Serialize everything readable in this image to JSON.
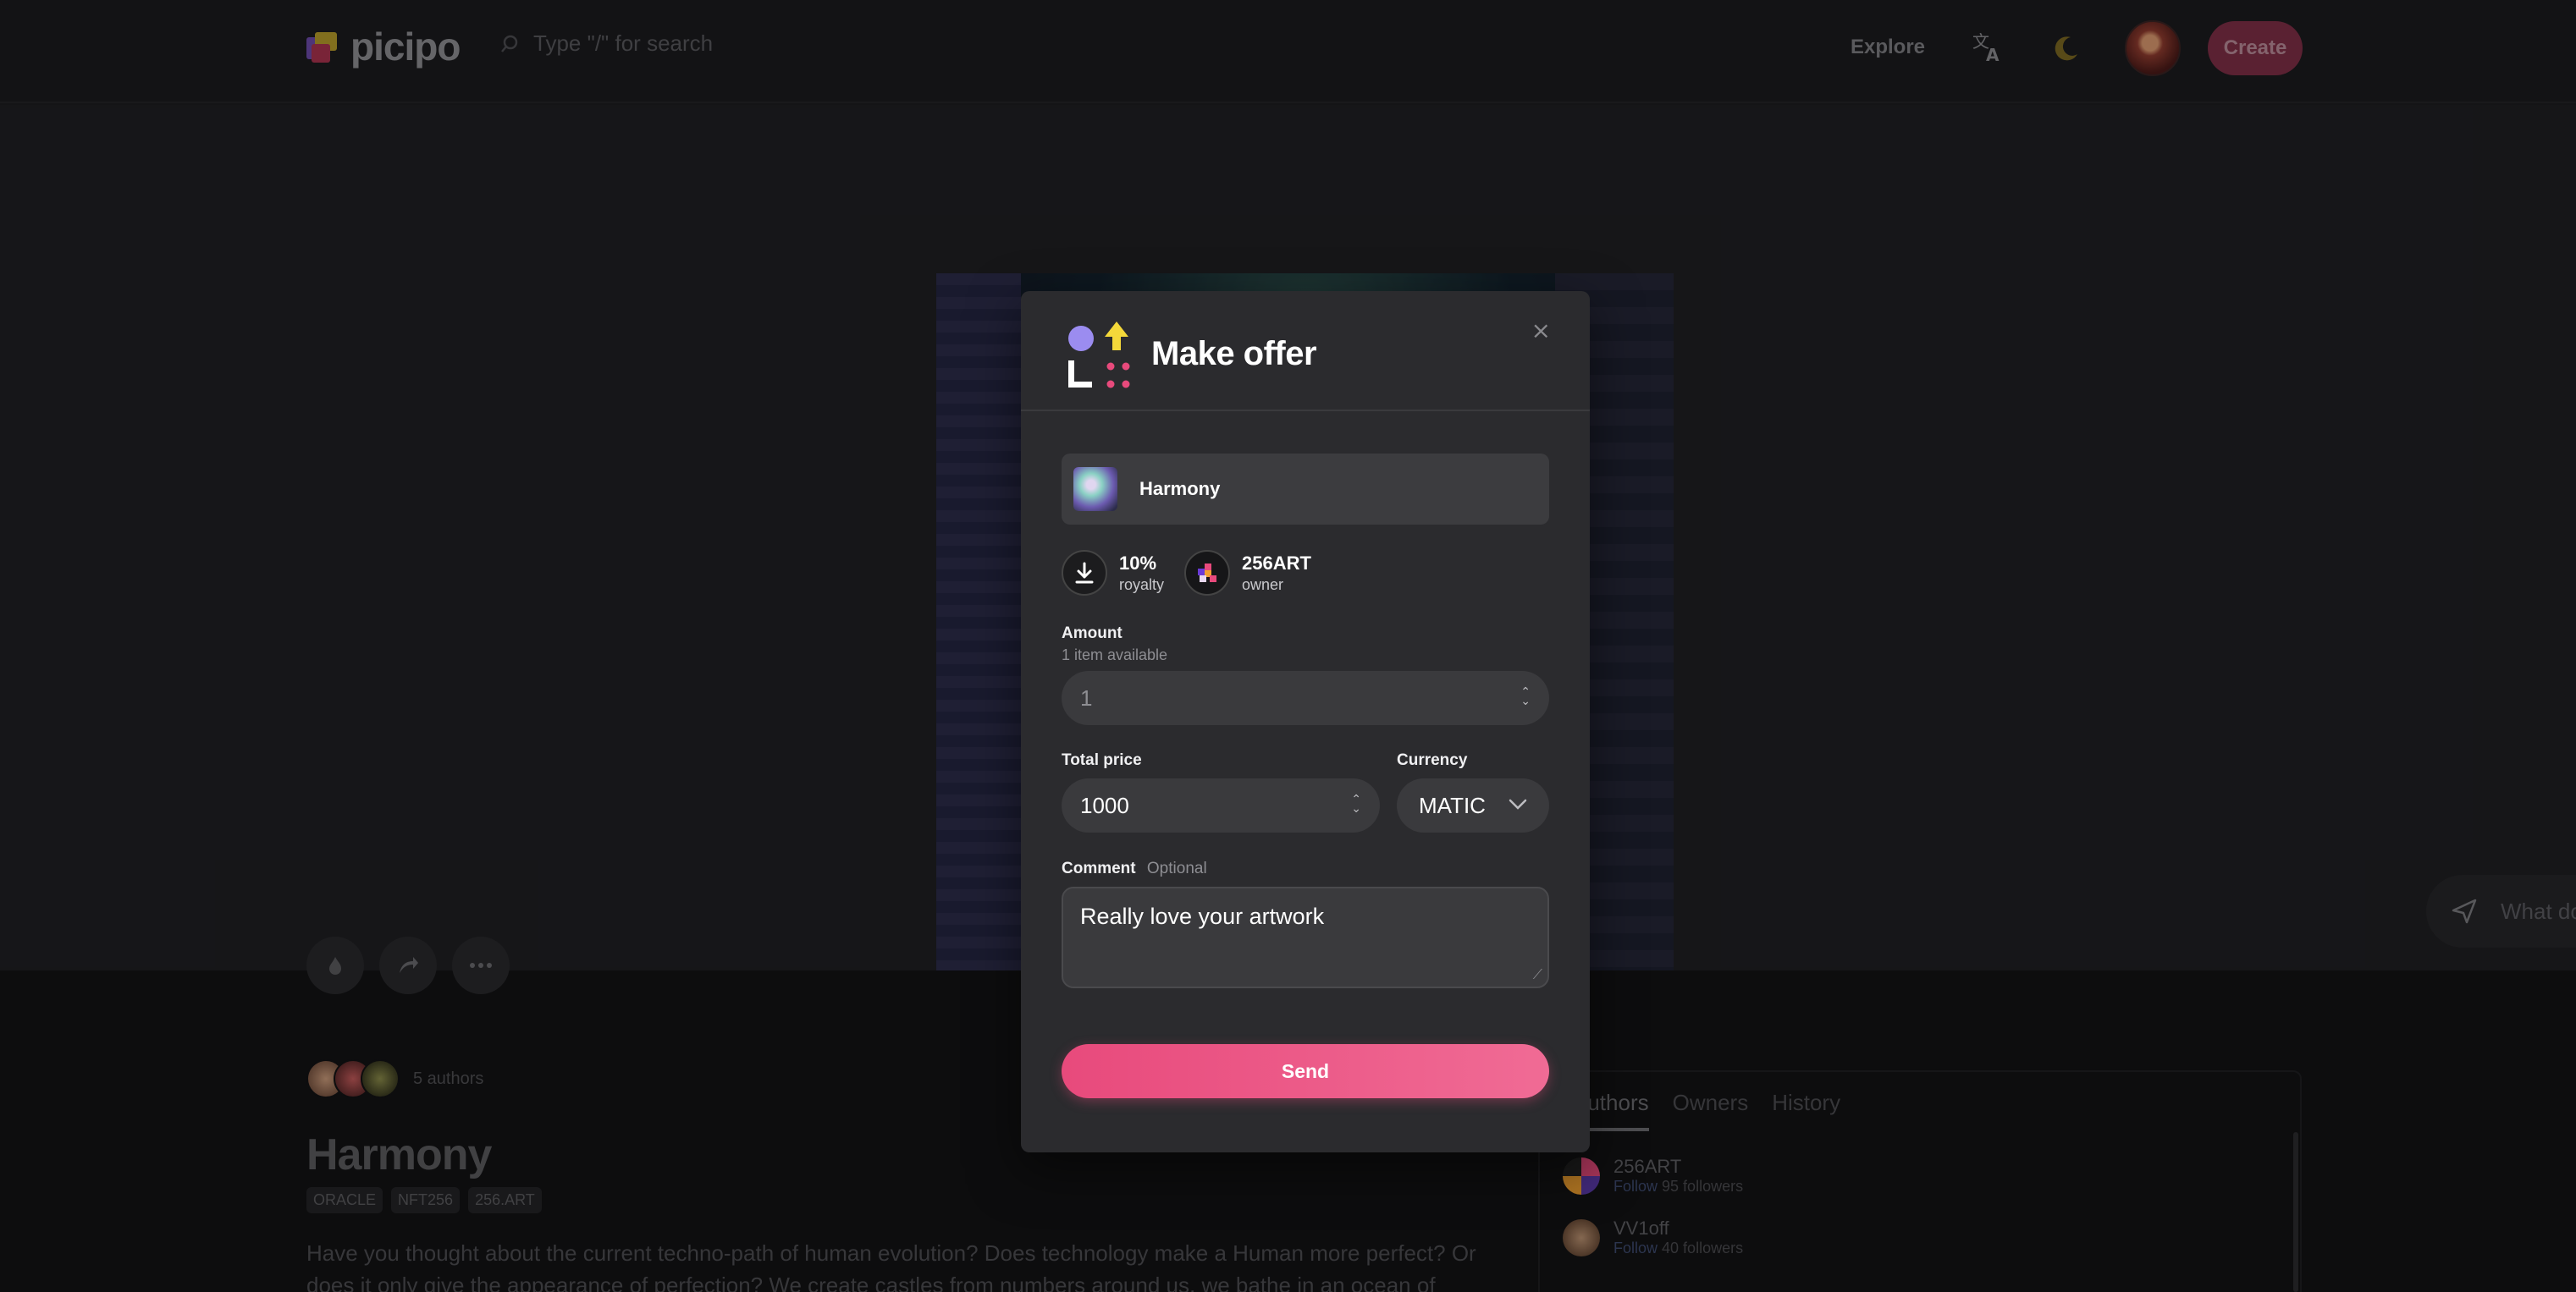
{
  "header": {
    "logo_text": "picipo",
    "search_placeholder": "Type \"/\" for search",
    "explore_label": "Explore",
    "create_label": "Create"
  },
  "chat": {
    "placeholder": "What do"
  },
  "artwork": {
    "authors_count": "5 authors",
    "title": "Harmony",
    "tags": [
      "ORACLE",
      "NFT256",
      "256.ART"
    ],
    "description": "Have you thought about the current techno-path of human evolution? Does technology make a Human more perfect? Or does it only give the appearance of perfection? We create castles from numbers around us, we bathe in an ocean of"
  },
  "side_panel": {
    "tabs": [
      "Authors",
      "Owners",
      "History"
    ],
    "items": [
      {
        "name": "256ART",
        "follow": "Follow",
        "followers": "95 followers"
      },
      {
        "name": "VV1off",
        "follow": "Follow",
        "followers": "40 followers"
      }
    ]
  },
  "modal": {
    "title": "Make offer",
    "close": "×",
    "item_name": "Harmony",
    "royalty_value": "10%",
    "royalty_label": "royalty",
    "owner_value": "256ART",
    "owner_label": "owner",
    "amount_label": "Amount",
    "amount_sub": "1 item available",
    "amount_value": "1",
    "price_label": "Total price",
    "price_value": "1000",
    "currency_label": "Currency",
    "currency_value": "MATIC",
    "comment_label": "Comment",
    "comment_optional": "Optional",
    "comment_value": "Really love your artwork",
    "send_label": "Send"
  },
  "colors": {
    "accent": "#e84a7c",
    "modal_bg": "#2b2b2e",
    "page_bg": "#1d1d1f"
  }
}
